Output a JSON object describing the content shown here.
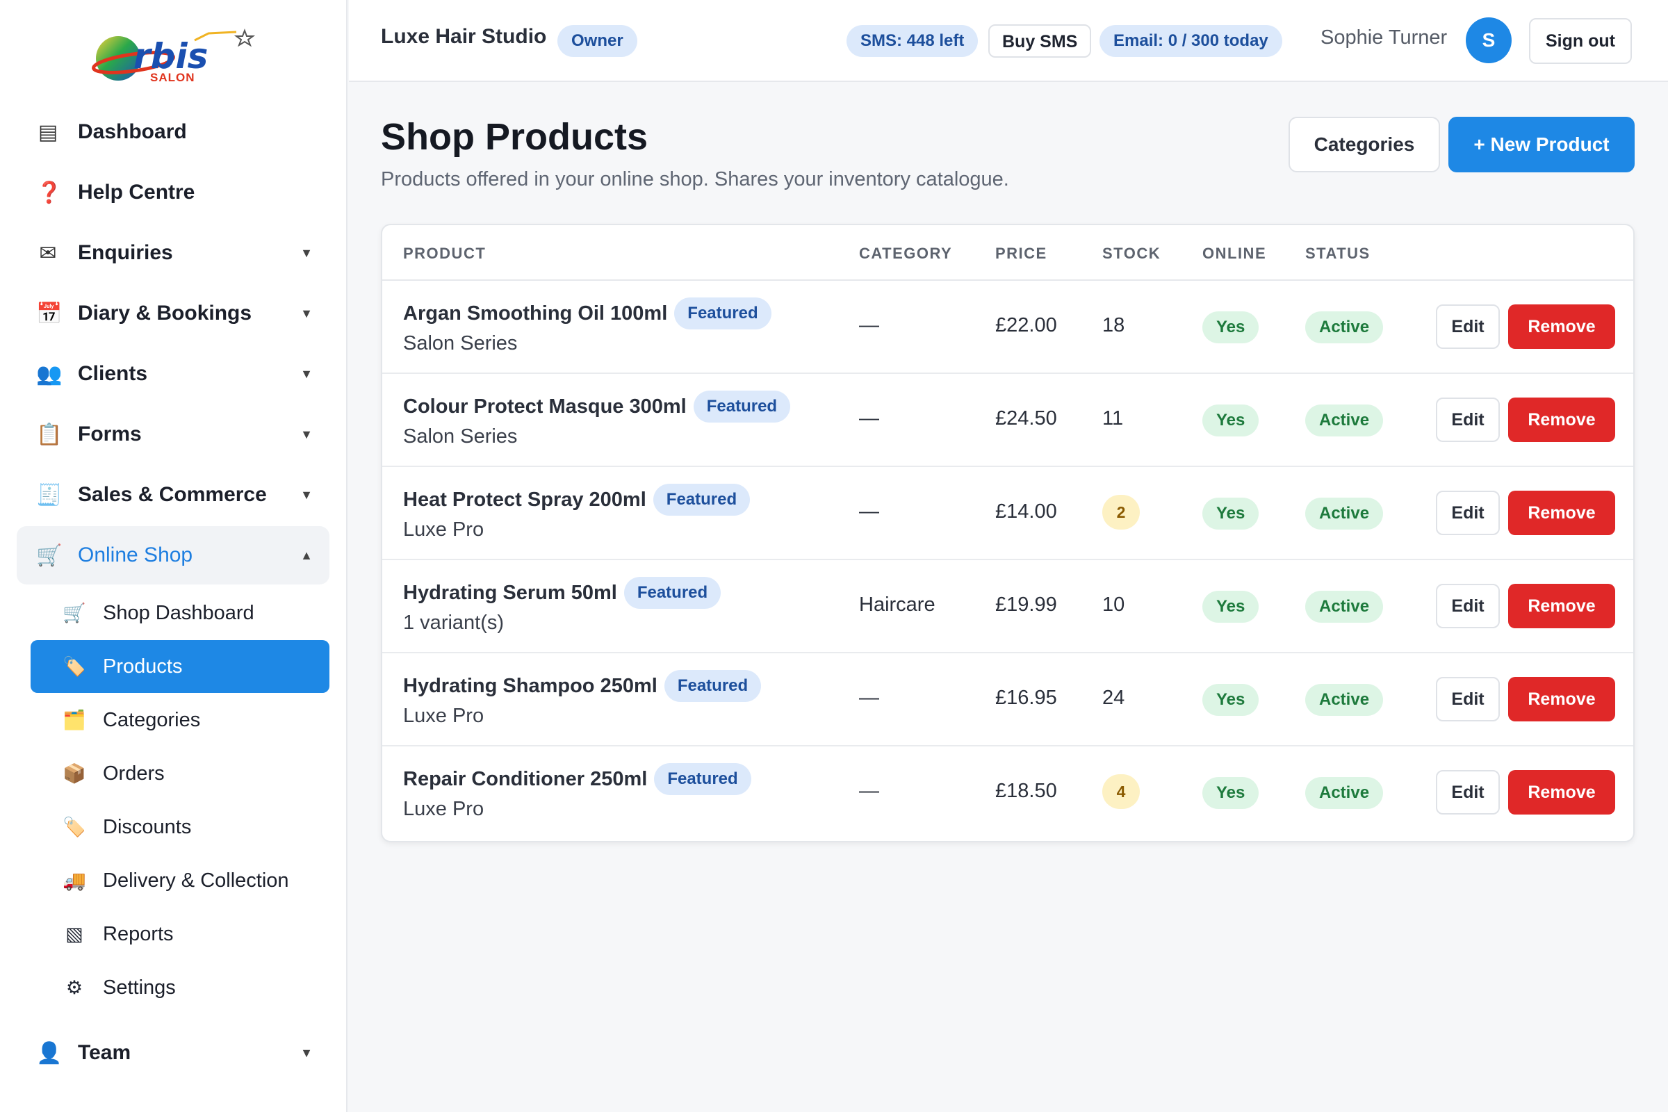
{
  "brand": {
    "logo_text": "rbis",
    "logo_sub": "SALON"
  },
  "sidebar": {
    "items": [
      {
        "label": "Dashboard",
        "icon": "dashboard-icon",
        "glyph": "▤"
      },
      {
        "label": "Help Centre",
        "icon": "help-icon",
        "glyph": "❓"
      },
      {
        "label": "Enquiries",
        "icon": "mail-icon",
        "glyph": "✉",
        "caret": "▼"
      },
      {
        "label": "Diary & Bookings",
        "icon": "calendar-icon",
        "glyph": "📅",
        "caret": "▼"
      },
      {
        "label": "Clients",
        "icon": "clients-icon",
        "glyph": "👥",
        "caret": "▼"
      },
      {
        "label": "Forms",
        "icon": "clipboard-icon",
        "glyph": "📋",
        "caret": "▼"
      },
      {
        "label": "Sales & Commerce",
        "icon": "receipt-icon",
        "glyph": "🧾",
        "caret": "▼"
      },
      {
        "label": "Online Shop",
        "icon": "cart-icon",
        "glyph": "🛒",
        "caret": "▲"
      }
    ],
    "shop_sub": [
      {
        "label": "Shop Dashboard",
        "icon": "cart-icon",
        "glyph": "🛒"
      },
      {
        "label": "Products",
        "icon": "tag-icon",
        "glyph": "🏷️"
      },
      {
        "label": "Categories",
        "icon": "folder-icon",
        "glyph": "🗂️"
      },
      {
        "label": "Orders",
        "icon": "package-icon",
        "glyph": "📦"
      },
      {
        "label": "Discounts",
        "icon": "discount-tag-icon",
        "glyph": "🏷️"
      },
      {
        "label": "Delivery & Collection",
        "icon": "truck-icon",
        "glyph": "🚚"
      },
      {
        "label": "Reports",
        "icon": "reports-icon",
        "glyph": "▧"
      },
      {
        "label": "Settings",
        "icon": "gear-icon",
        "glyph": "⚙"
      }
    ],
    "team": {
      "label": "Team",
      "icon": "user-icon",
      "glyph": "👤",
      "caret": "▼"
    }
  },
  "header": {
    "studio": "Luxe Hair Studio",
    "role": "Owner",
    "sms": "SMS: 448 left",
    "buy_sms": "Buy SMS",
    "email": "Email: 0 / 300 today",
    "user": "Sophie Turner",
    "avatar": "S",
    "sign_out": "Sign out"
  },
  "main": {
    "title": "Shop Products",
    "subtitle": "Products offered in your online shop. Shares your inventory catalogue.",
    "categories_btn": "Categories",
    "new_btn": "+ New Product"
  },
  "table": {
    "columns": [
      "PRODUCT",
      "CATEGORY",
      "PRICE",
      "STOCK",
      "ONLINE",
      "STATUS"
    ],
    "featured_label": "Featured",
    "edit_label": "Edit",
    "remove_label": "Remove",
    "rows": [
      {
        "name": "Argan Smoothing Oil 100ml",
        "featured": true,
        "brand": "Salon Series",
        "category": "—",
        "price": "£22.00",
        "stock": "18",
        "low_stock": false,
        "online": "Yes",
        "status": "Active"
      },
      {
        "name": "Colour Protect Masque 300ml",
        "featured": true,
        "brand": "Salon Series",
        "category": "—",
        "price": "£24.50",
        "stock": "11",
        "low_stock": false,
        "online": "Yes",
        "status": "Active"
      },
      {
        "name": "Heat Protect Spray 200ml",
        "featured": true,
        "brand": "Luxe Pro",
        "category": "—",
        "price": "£14.00",
        "stock": "2",
        "low_stock": true,
        "online": "Yes",
        "status": "Active"
      },
      {
        "name": "Hydrating Serum 50ml",
        "featured": true,
        "brand": "1 variant(s)",
        "category": "Haircare",
        "price": "£19.99",
        "stock": "10",
        "low_stock": false,
        "online": "Yes",
        "status": "Active"
      },
      {
        "name": "Hydrating Shampoo 250ml",
        "featured": true,
        "brand": "Luxe Pro",
        "category": "—",
        "price": "£16.95",
        "stock": "24",
        "low_stock": false,
        "online": "Yes",
        "status": "Active"
      },
      {
        "name": "Repair Conditioner 250ml",
        "featured": true,
        "brand": "Luxe Pro",
        "category": "—",
        "price": "£18.50",
        "stock": "4",
        "low_stock": true,
        "online": "Yes",
        "status": "Active"
      }
    ]
  },
  "colors": {
    "accent": "#1e88e5",
    "danger": "#e02828",
    "success_bg": "#ddf5e5",
    "success_fg": "#1d7a3c",
    "warn_bg": "#fdf1c3"
  }
}
